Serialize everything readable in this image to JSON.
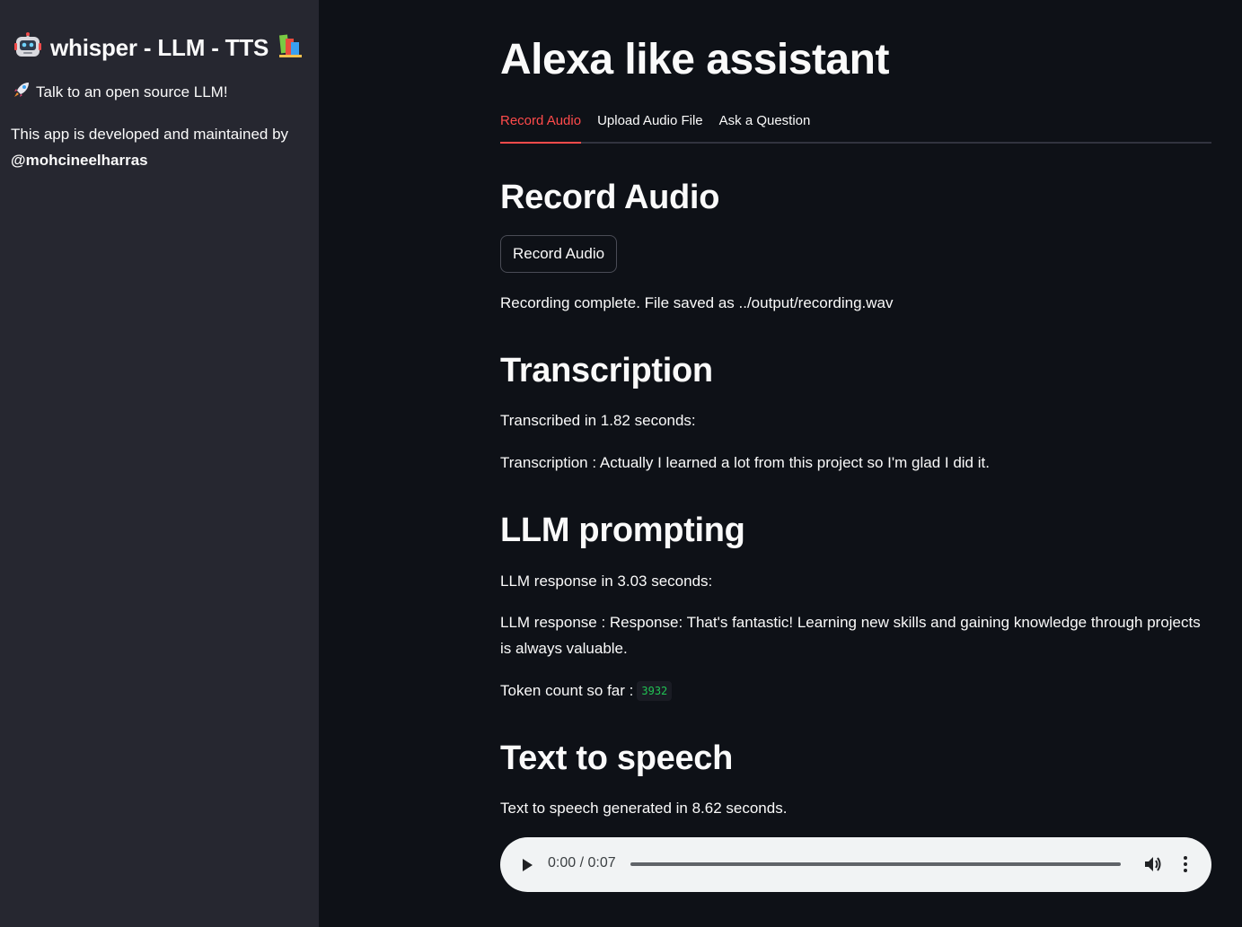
{
  "sidebar": {
    "robot_emoji": "🤖",
    "title": "whisper - LLM - TTS",
    "books_emoji": "📚",
    "rocket_emoji": "🚀",
    "tagline": "Talk to an open source LLM!",
    "credit_text": "This app is developed and maintained by",
    "credit_handle": "@mohcineelharras"
  },
  "main": {
    "title": "Alexa like assistant",
    "tabs": [
      {
        "label": "Record Audio",
        "active": true
      },
      {
        "label": "Upload Audio File",
        "active": false
      },
      {
        "label": "Ask a Question",
        "active": false
      }
    ],
    "record": {
      "heading": "Record Audio",
      "button_label": "Record Audio",
      "status": "Recording complete. File saved as ../output/recording.wav"
    },
    "transcription": {
      "heading": "Transcription",
      "timing": "Transcribed in 1.82 seconds:",
      "text": "Transcription : Actually I learned a lot from this project so I'm glad I did it."
    },
    "llm": {
      "heading": "LLM prompting",
      "timing": "LLM response in 3.03 seconds:",
      "response": "LLM response : Response: That's fantastic! Learning new skills and gaining knowledge through projects is always valuable.",
      "token_label": "Token count so far :",
      "token_count": "3932"
    },
    "tts": {
      "heading": "Text to speech",
      "timing": "Text to speech generated in 8.62 seconds.",
      "audio": {
        "time": "0:00 / 0:07",
        "progress": 0
      }
    }
  },
  "colors": {
    "background": "#0e1117",
    "sidebar": "#262730",
    "accent": "#ff4b4b",
    "code_text": "#21c354"
  },
  "icons": [
    "robot-icon",
    "books-icon",
    "rocket-icon",
    "play-icon",
    "volume-icon",
    "more-vert-icon"
  ]
}
